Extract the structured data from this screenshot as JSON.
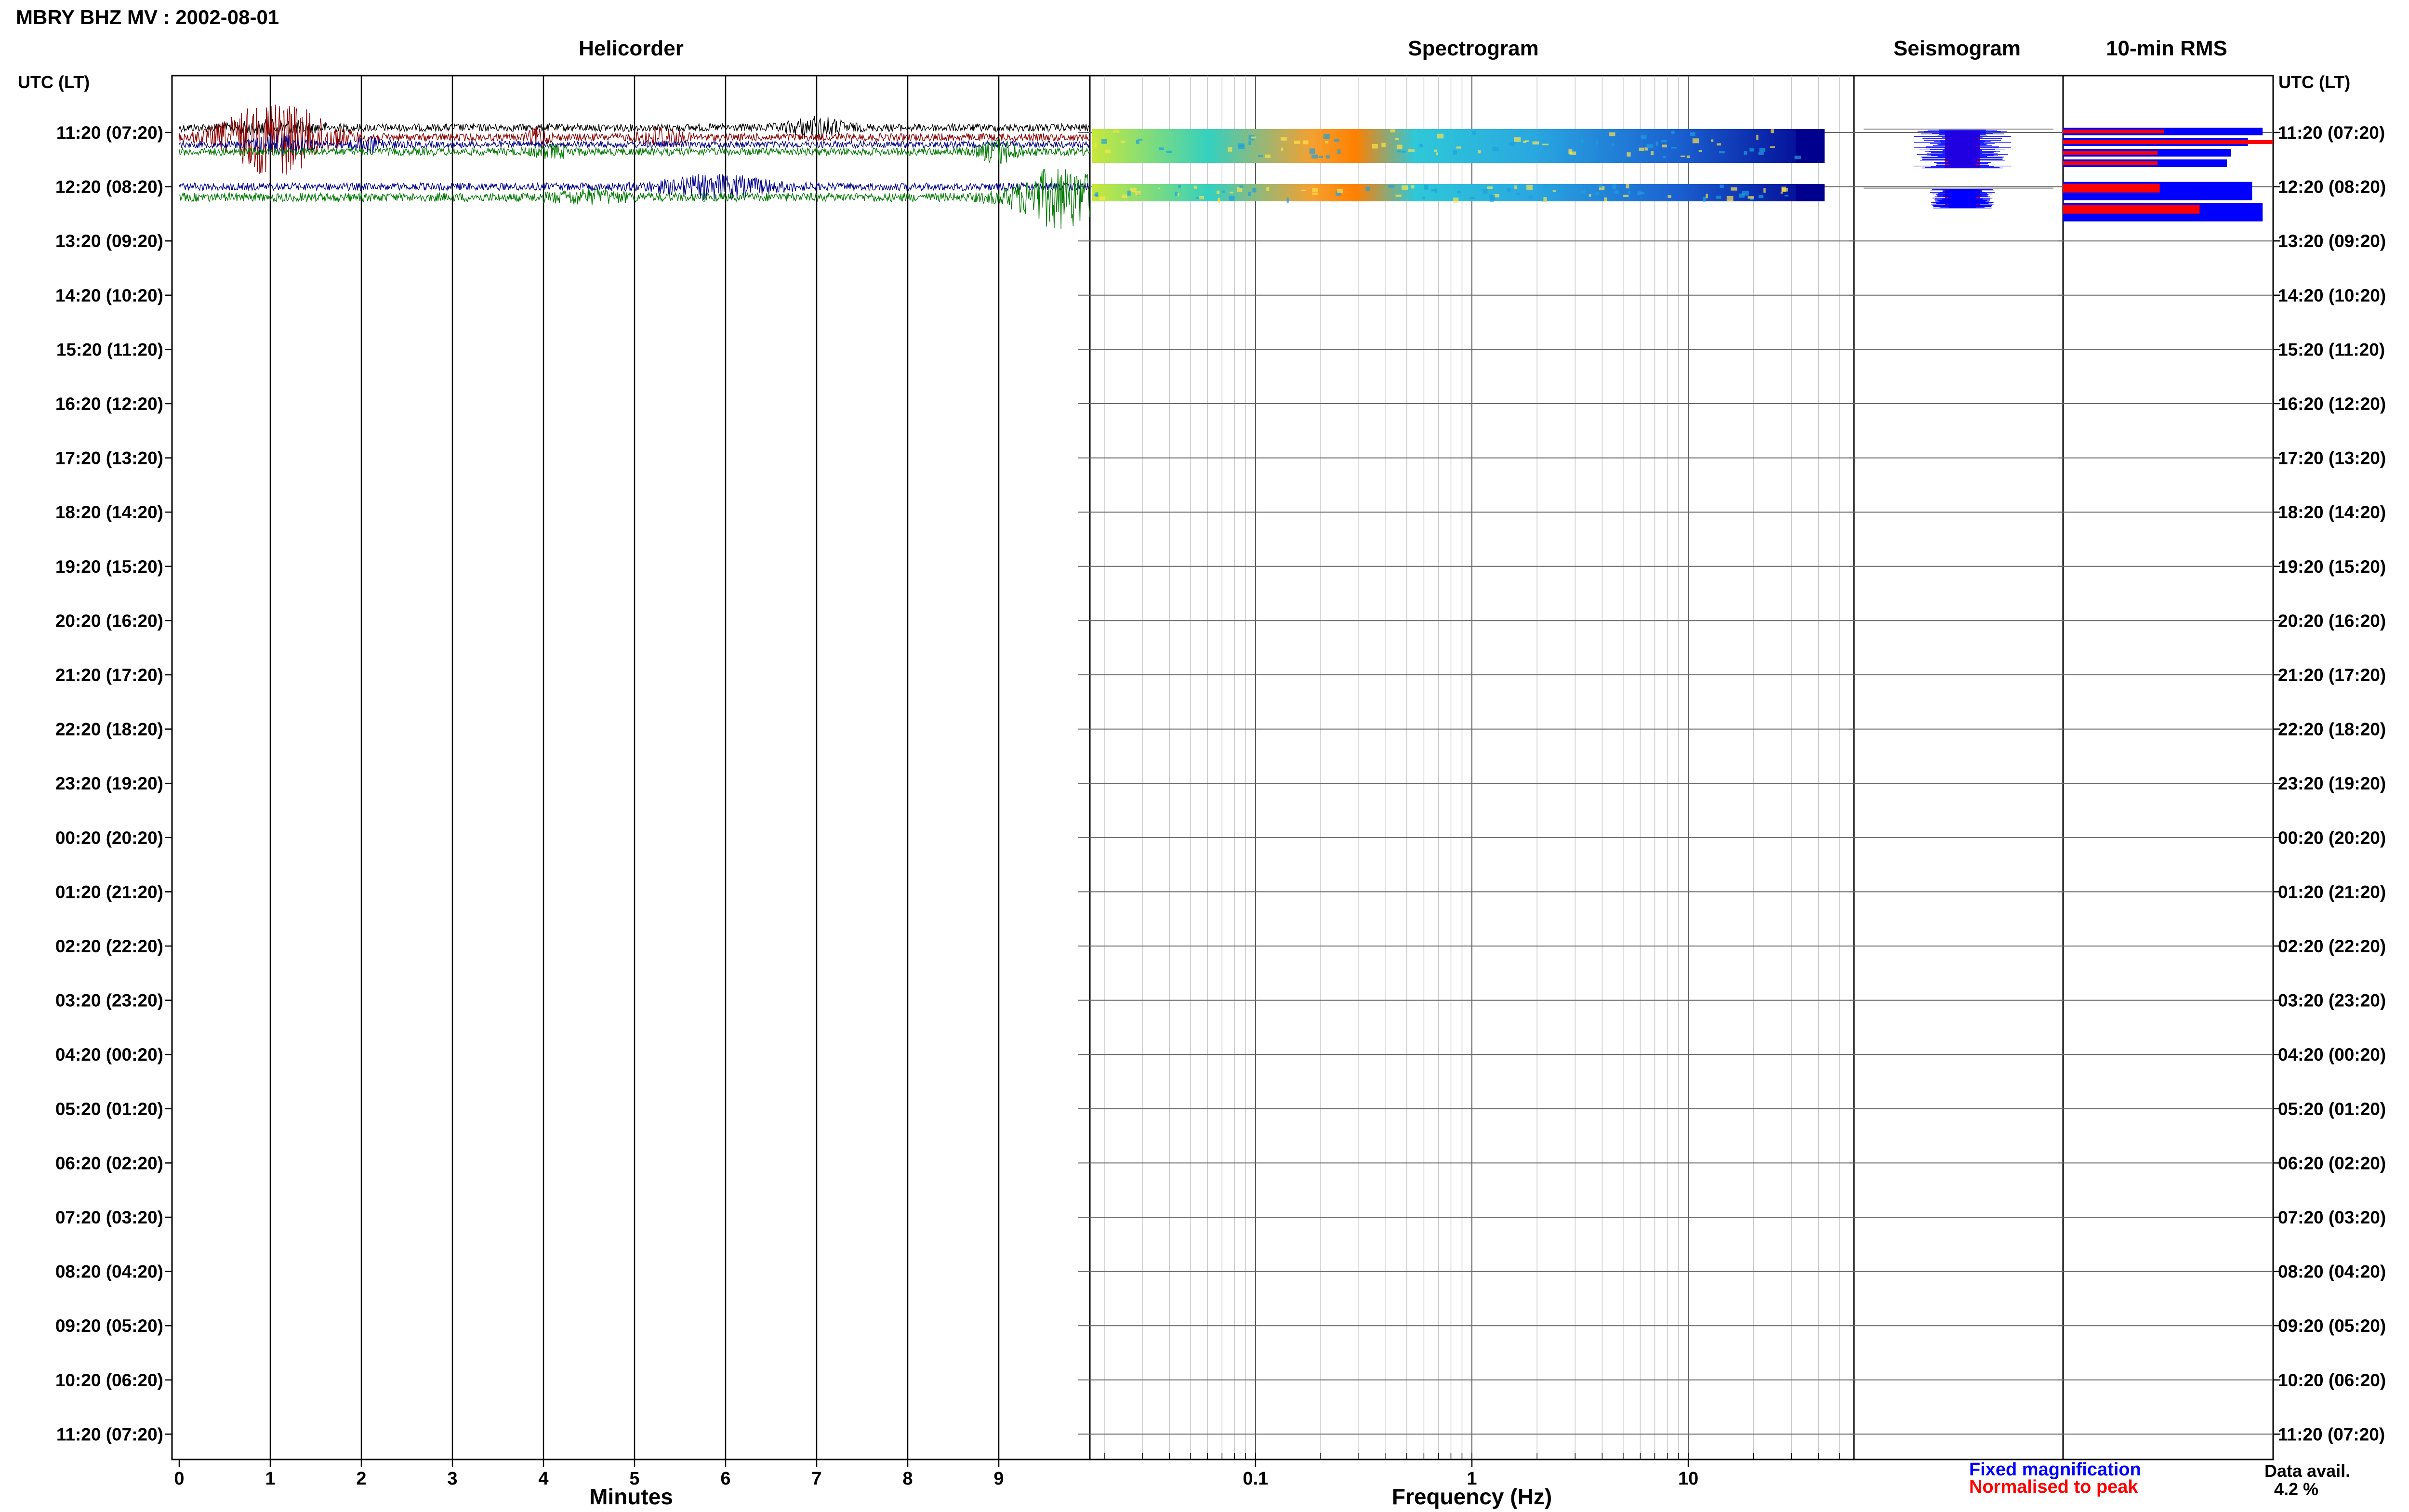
{
  "header": {
    "title": "MBRY BHZ MV : 2002-08-01"
  },
  "panels": {
    "helicorder": "Helicorder",
    "spectrogram": "Spectrogram",
    "seismogram": "Seismogram",
    "rms": "10-min RMS"
  },
  "axis": {
    "utc_left": "UTC (LT)",
    "utc_right": "UTC (LT)",
    "minutes_label": "Minutes",
    "freq_label": "Frequency (Hz)"
  },
  "legend": {
    "fixed": "Fixed magnification",
    "normalised": "Normalised to peak",
    "fixed_color": "#0000ff",
    "normalised_color": "#ff0000"
  },
  "availability": {
    "label": "Data avail.",
    "value": "4.2 %"
  },
  "colors": {
    "trace_colors": [
      "#000000",
      "#8b0000",
      "#00008b",
      "#007a00"
    ],
    "spectro_low": "#00008f",
    "spectro_high": "#ff8000"
  },
  "chart_data": {
    "type": "helicorder",
    "row_labels": [
      "11:20 (07:20)",
      "12:20 (08:20)",
      "13:20 (09:20)",
      "14:20 (10:20)",
      "15:20 (11:20)",
      "16:20 (12:20)",
      "17:20 (13:20)",
      "18:20 (14:20)",
      "19:20 (15:20)",
      "20:20 (16:20)",
      "21:20 (17:20)",
      "22:20 (18:20)",
      "23:20 (19:20)",
      "00:20 (20:20)",
      "01:20 (21:20)",
      "02:20 (22:20)",
      "03:20 (23:20)",
      "04:20 (00:20)",
      "05:20 (01:20)",
      "06:20 (02:20)",
      "07:20 (03:20)",
      "08:20 (04:20)",
      "09:20 (05:20)",
      "10:20 (06:20)",
      "11:20 (07:20)"
    ],
    "minute_ticks": [
      "0",
      "1",
      "2",
      "3",
      "4",
      "5",
      "6",
      "7",
      "8",
      "9"
    ],
    "minutes_range": [
      0,
      10
    ],
    "freq_ticks": [
      "0.1",
      "1",
      "10"
    ],
    "freq_range": [
      0.02,
      50
    ],
    "freq_scale": "log",
    "data_rows": 2,
    "rms_fixed": [
      [
        0.95,
        0.88,
        0.8,
        0.78
      ],
      [
        0.9,
        0.95
      ]
    ],
    "rms_normalised": [
      [
        0.48,
        1.0,
        0.45,
        0.45
      ],
      [
        0.46,
        0.65
      ]
    ]
  }
}
